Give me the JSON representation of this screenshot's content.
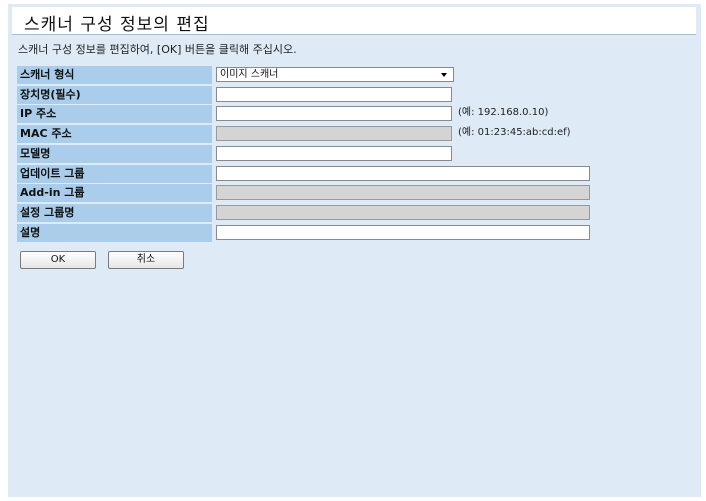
{
  "title": "스캐너 구성 정보의 편집",
  "instruction": "스캐너 구성 정보를 편집하여, [OK] 버튼을 클릭해 주십시오.",
  "rows": [
    {
      "label": "스캐너 형식",
      "value": "이미지 스캐너",
      "hint": ""
    },
    {
      "label": "장치명(필수)",
      "value": "",
      "hint": ""
    },
    {
      "label": "IP 주소",
      "value": "",
      "hint": "(예: 192.168.0.10)"
    },
    {
      "label": "MAC 주소",
      "value": "",
      "hint": "(예: 01:23:45:ab:cd:ef)"
    },
    {
      "label": "모델명",
      "value": "",
      "hint": ""
    },
    {
      "label": "업데이트 그룹",
      "value": "",
      "hint": ""
    },
    {
      "label": "Add-in 그룹",
      "value": "",
      "hint": ""
    },
    {
      "label": "설정 그룹명",
      "value": "",
      "hint": ""
    },
    {
      "label": "설명",
      "value": "",
      "hint": ""
    }
  ],
  "buttons": {
    "ok": "OK",
    "cancel": "취소"
  },
  "colors": {
    "panel_bg": "#deeaf5",
    "label_bg": "#a9cdea",
    "disabled_field": "#d4d4d4"
  },
  "icons": {
    "select_arrow": "chevron-down-icon"
  }
}
